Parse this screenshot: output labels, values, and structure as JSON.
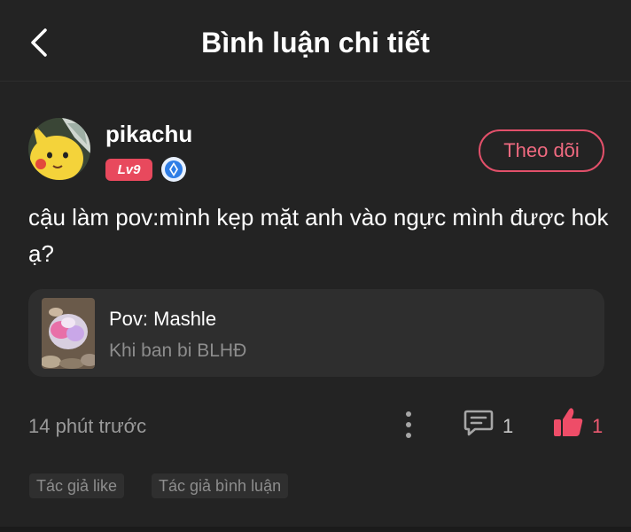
{
  "header": {
    "title": "Bình luận chi tiết"
  },
  "user": {
    "name": "pikachu",
    "level": "Lv9",
    "follow_label": "Theo dõi"
  },
  "comment": {
    "text": "cậu làm pov:mình kẹp mặt anh vào ngực mình được hok ạ?"
  },
  "story": {
    "title": "Pov: Mashle",
    "subtitle": "Khi ban bi BLHĐ"
  },
  "meta": {
    "time": "14 phút trước",
    "reply_count": "1",
    "like_count": "1"
  },
  "tags": [
    "Tác giả like",
    "Tác giả bình luận"
  ],
  "colors": {
    "background": "#232323",
    "accent": "#e8495d",
    "card": "#2e2e2e",
    "muted": "#8d8d8d"
  }
}
